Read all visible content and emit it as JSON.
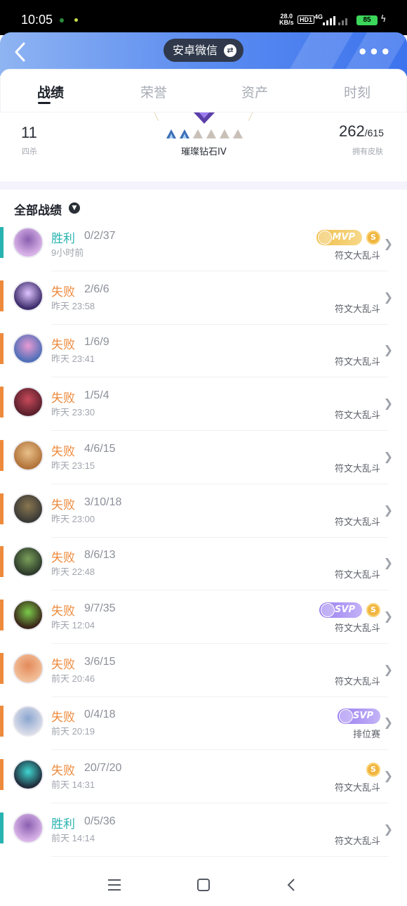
{
  "status_bar": {
    "time": "10:05",
    "net_speed": "28.0",
    "net_unit": "KB/s",
    "hd": "HD1",
    "signal": "4G",
    "battery": "85"
  },
  "header": {
    "title": "安卓微信",
    "accent_start": "#8fb4f2",
    "accent_end": "#3d74ee"
  },
  "tabs": [
    {
      "label": "战绩",
      "active": true
    },
    {
      "label": "荣誉",
      "active": false
    },
    {
      "label": "资产",
      "active": false
    },
    {
      "label": "时刻",
      "active": false
    }
  ],
  "summary": {
    "quadra_value": "11",
    "quadra_label": "四杀",
    "rank_name": "璀璨钻石IV",
    "skins_owned": "262",
    "skins_total": "/615",
    "skins_label": "拥有皮肤"
  },
  "section": {
    "title": "全部战绩"
  },
  "colors": {
    "win": "#29b3b0",
    "loss": "#ee8a3c"
  },
  "matches": [
    {
      "result": "胜利",
      "kda": "0/2/37",
      "when": "9小时前",
      "mode": "符文大乱斗",
      "win": true,
      "badge": "MVP",
      "coin": true,
      "avatar": "avatar-pink"
    },
    {
      "result": "失败",
      "kda": "2/6/6",
      "when": "昨天 23:58",
      "mode": "符文大乱斗",
      "win": false,
      "badge": "",
      "coin": false,
      "avatar": "avatar-purple"
    },
    {
      "result": "失败",
      "kda": "1/6/9",
      "when": "昨天 23:41",
      "mode": "符文大乱斗",
      "win": false,
      "badge": "",
      "coin": false,
      "avatar": "avatar-blue"
    },
    {
      "result": "失败",
      "kda": "1/5/4",
      "when": "昨天 23:30",
      "mode": "符文大乱斗",
      "win": false,
      "badge": "",
      "coin": false,
      "avatar": "avatar-red"
    },
    {
      "result": "失败",
      "kda": "4/6/15",
      "when": "昨天 23:15",
      "mode": "符文大乱斗",
      "win": false,
      "badge": "",
      "coin": false,
      "avatar": "avatar-teemo"
    },
    {
      "result": "失败",
      "kda": "3/10/18",
      "when": "昨天 23:00",
      "mode": "符文大乱斗",
      "win": false,
      "badge": "",
      "coin": false,
      "avatar": "avatar-dark"
    },
    {
      "result": "失败",
      "kda": "8/6/13",
      "when": "昨天 22:48",
      "mode": "符文大乱斗",
      "win": false,
      "badge": "",
      "coin": false,
      "avatar": "avatar-green"
    },
    {
      "result": "失败",
      "kda": "9/7/35",
      "when": "昨天 12:04",
      "mode": "符文大乱斗",
      "win": false,
      "badge": "SVP",
      "coin": true,
      "avatar": "avatar-mask"
    },
    {
      "result": "失败",
      "kda": "3/6/15",
      "when": "前天 20:46",
      "mode": "符文大乱斗",
      "win": false,
      "badge": "",
      "coin": false,
      "avatar": "avatar-blonde"
    },
    {
      "result": "失败",
      "kda": "0/4/18",
      "when": "前天 20:19",
      "mode": "排位赛",
      "win": false,
      "badge": "SVP",
      "coin": false,
      "avatar": "avatar-white"
    },
    {
      "result": "失败",
      "kda": "20/7/20",
      "when": "前天 14:31",
      "mode": "符文大乱斗",
      "win": false,
      "badge": "",
      "coin": true,
      "avatar": "avatar-cyan"
    },
    {
      "result": "胜利",
      "kda": "0/5/36",
      "when": "前天 14:14",
      "mode": "符文大乱斗",
      "win": true,
      "badge": "",
      "coin": false,
      "avatar": "avatar-pink"
    }
  ]
}
